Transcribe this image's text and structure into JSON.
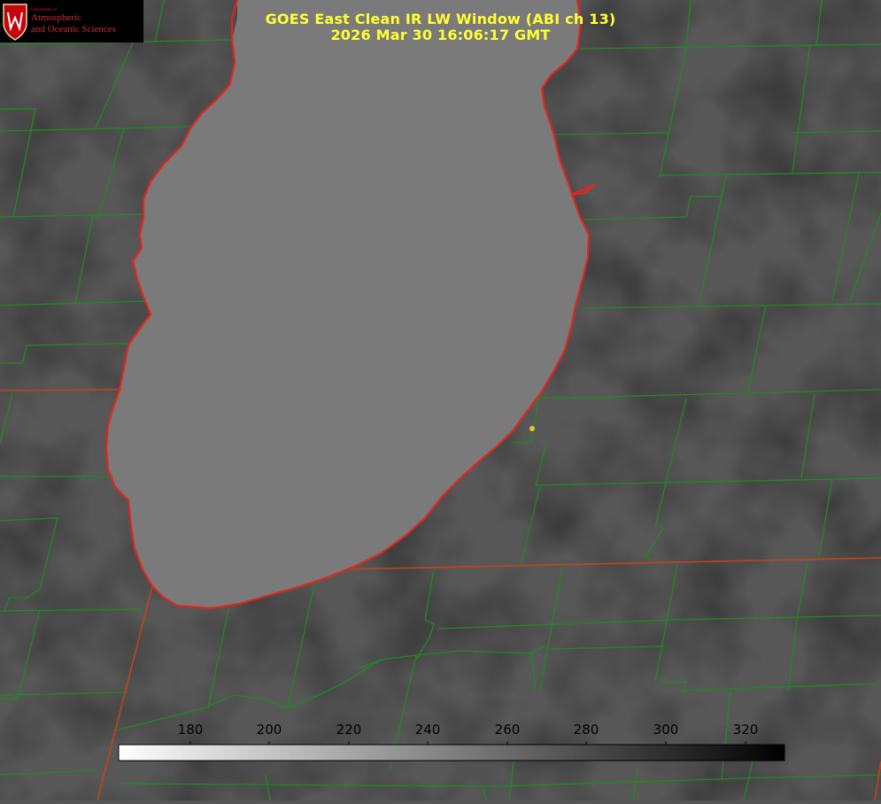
{
  "logo": {
    "small": "Department of",
    "line1": "Atmospheric",
    "line2": "and Oceanic Sciences"
  },
  "title": {
    "line1": "GOES East Clean IR LW Window (ABI ch 13)",
    "line2": "2026 Mar 30 16:06:17 GMT"
  },
  "colorbar": {
    "ticks": [
      "180",
      "200",
      "220",
      "240",
      "260",
      "280",
      "300",
      "320"
    ]
  },
  "colors": {
    "lake": "#7a7a7a",
    "land": "#585858",
    "coast": "#e0261e",
    "county": "#1f8a1f",
    "state": "#b9441c",
    "title": "#ffff33",
    "marker": "#dccc20"
  }
}
